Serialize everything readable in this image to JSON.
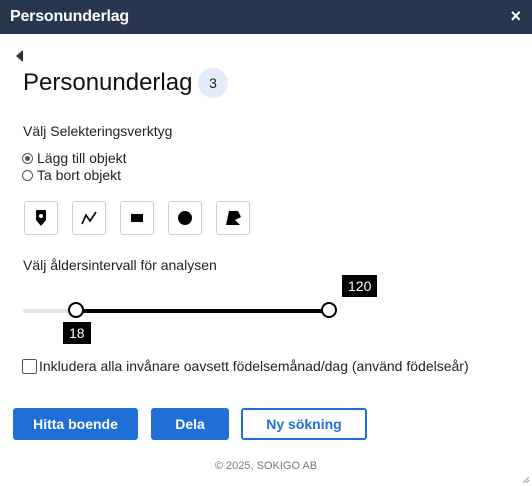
{
  "window": {
    "title": "Personunderlag",
    "close_label": "×"
  },
  "panel": {
    "heading": "Personunderlag",
    "count": "3",
    "selection_label": "Välj Selekteringsverktyg",
    "radio_options": [
      {
        "label": "Lägg till objekt",
        "checked": true
      },
      {
        "label": "Ta bort objekt",
        "checked": false
      }
    ],
    "tools": [
      {
        "name": "point-tool",
        "icon": "pin-icon"
      },
      {
        "name": "line-tool",
        "icon": "polyline-icon"
      },
      {
        "name": "rectangle-tool",
        "icon": "rectangle-icon"
      },
      {
        "name": "circle-tool",
        "icon": "circle-icon"
      },
      {
        "name": "polygon-tool",
        "icon": "polygon-icon"
      }
    ],
    "range_label": "Välj åldersintervall för analysen",
    "range": {
      "min": 0,
      "max": 120,
      "low": 18,
      "high": 120,
      "low_label": "18",
      "high_label": "120"
    },
    "checkbox_label": "Inkludera alla invånare oavsett födelsemånad/dag (använd födelseår)",
    "checkbox_checked": false,
    "buttons": {
      "find": "Hitta boende",
      "share": "Dela",
      "new_search": "Ny sökning"
    },
    "footer": "© 2025, SOKIGO AB"
  },
  "colors": {
    "titlebar": "#2a3650",
    "primary": "#1f6fd6",
    "badge": "#e3ecfa"
  }
}
